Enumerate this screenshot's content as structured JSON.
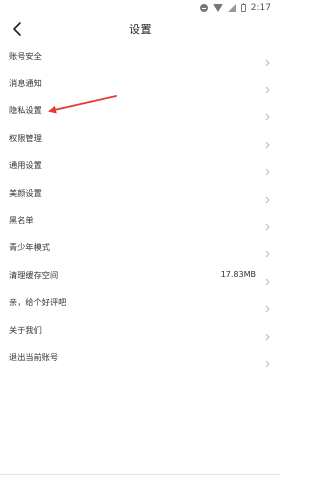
{
  "status_bar": {
    "time": "2:17",
    "icons": [
      "do-not-disturb-icon",
      "wifi-icon",
      "signal-icon",
      "battery-icon"
    ]
  },
  "header": {
    "title": "设置",
    "back_icon": "chevron-left-icon"
  },
  "menu": {
    "items": [
      {
        "label": "账号安全",
        "value": ""
      },
      {
        "label": "消息通知",
        "value": ""
      },
      {
        "label": "隐私设置",
        "value": ""
      },
      {
        "label": "权限管理",
        "value": ""
      },
      {
        "label": "通用设置",
        "value": ""
      },
      {
        "label": "美颜设置",
        "value": ""
      },
      {
        "label": "黑名单",
        "value": ""
      },
      {
        "label": "青少年模式",
        "value": ""
      },
      {
        "label": "清理缓存空间",
        "value": "17.83MB"
      },
      {
        "label": "亲，给个好评吧",
        "value": ""
      },
      {
        "label": "关于我们",
        "value": ""
      },
      {
        "label": "退出当前账号",
        "value": ""
      }
    ]
  },
  "annotation": {
    "color": "#e53935",
    "target": "隐私设置"
  },
  "colors": {
    "background": "#ffffff",
    "text": "#333333",
    "chevron": "#bbbbbb"
  }
}
